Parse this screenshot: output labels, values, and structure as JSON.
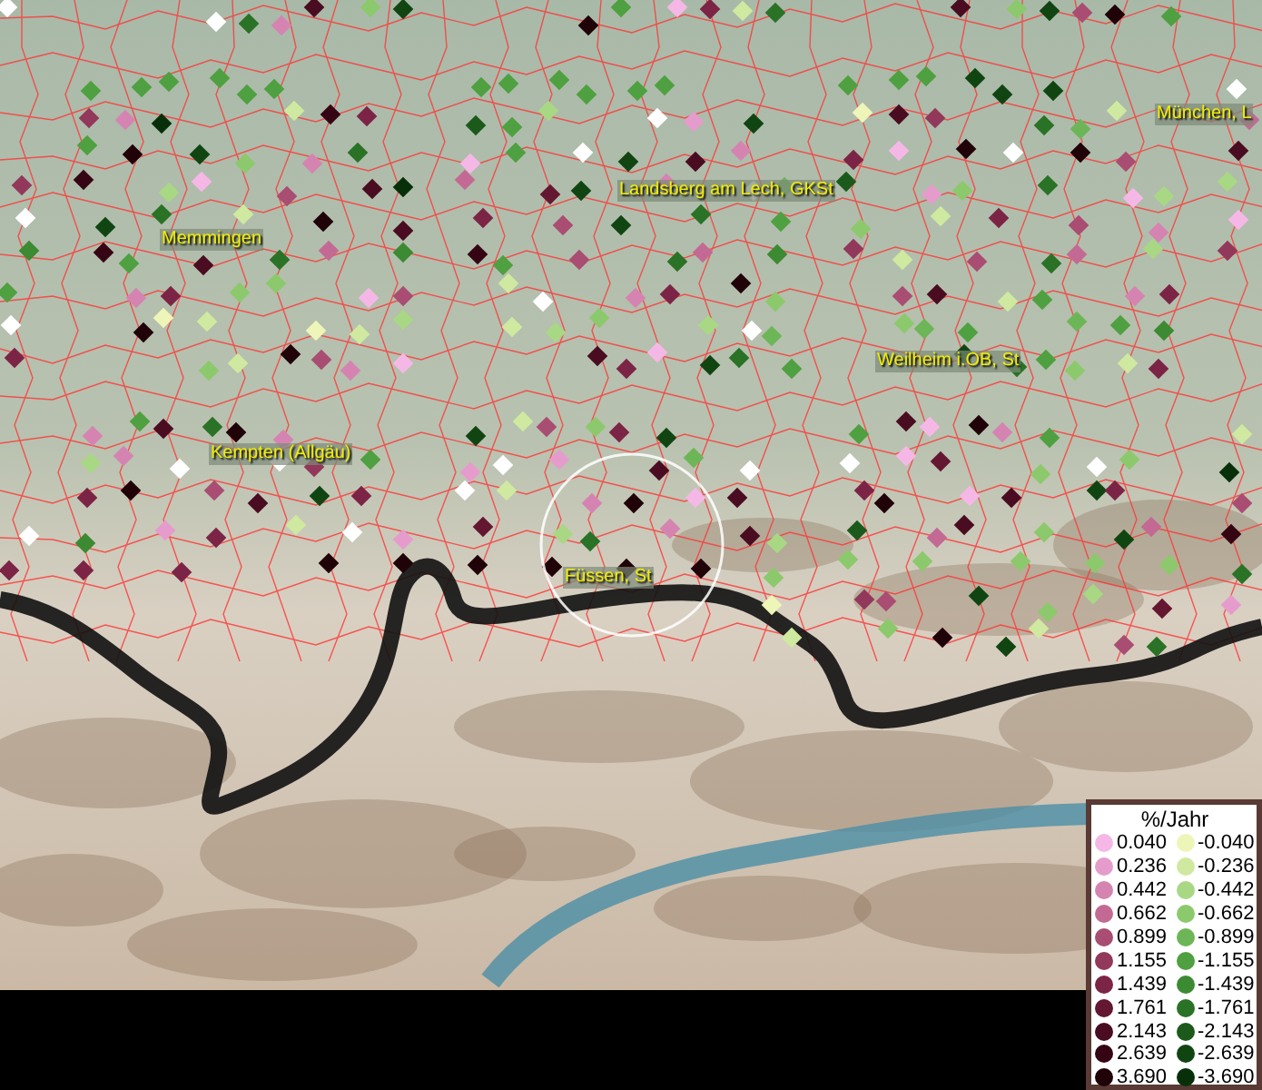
{
  "map": {
    "places": [
      {
        "name": "München, L"
      },
      {
        "name": "Landsberg am Lech, GKSt"
      },
      {
        "name": "Memmingen"
      },
      {
        "name": "Weilheim i.OB, St"
      },
      {
        "name": "Kempten (Allgäu)"
      },
      {
        "name": "Füssen, St"
      }
    ]
  },
  "legend": {
    "title": "%/Jahr",
    "columns": [
      [
        {
          "label": "0.040",
          "color": "#f5b8e6"
        },
        {
          "label": "0.236",
          "color": "#e59ccd"
        },
        {
          "label": "0.442",
          "color": "#d584b2"
        },
        {
          "label": "0.662",
          "color": "#c36a94"
        },
        {
          "label": "0.899",
          "color": "#a94d72"
        },
        {
          "label": "1.155",
          "color": "#92385a"
        },
        {
          "label": "1.439",
          "color": "#7c2446"
        },
        {
          "label": "1.761",
          "color": "#641731"
        },
        {
          "label": "2.143",
          "color": "#4a0c20"
        },
        {
          "label": "2.639",
          "color": "#360514"
        },
        {
          "label": "3.690",
          "color": "#200209"
        }
      ],
      [
        {
          "label": "-0.040",
          "color": "#eef5b8"
        },
        {
          "label": "-0.236",
          "color": "#cfe9a0"
        },
        {
          "label": "-0.442",
          "color": "#a9d884"
        },
        {
          "label": "-0.662",
          "color": "#8cc96c"
        },
        {
          "label": "-0.899",
          "color": "#6db657"
        },
        {
          "label": "-1.155",
          "color": "#4fa040"
        },
        {
          "label": "-1.439",
          "color": "#3c8a32"
        },
        {
          "label": "-1.761",
          "color": "#2a7226"
        },
        {
          "label": "-2.143",
          "color": "#1b5a1a"
        },
        {
          "label": "-2.639",
          "color": "#104512"
        },
        {
          "label": "-3.690",
          "color": "#07300a"
        }
      ]
    ]
  }
}
